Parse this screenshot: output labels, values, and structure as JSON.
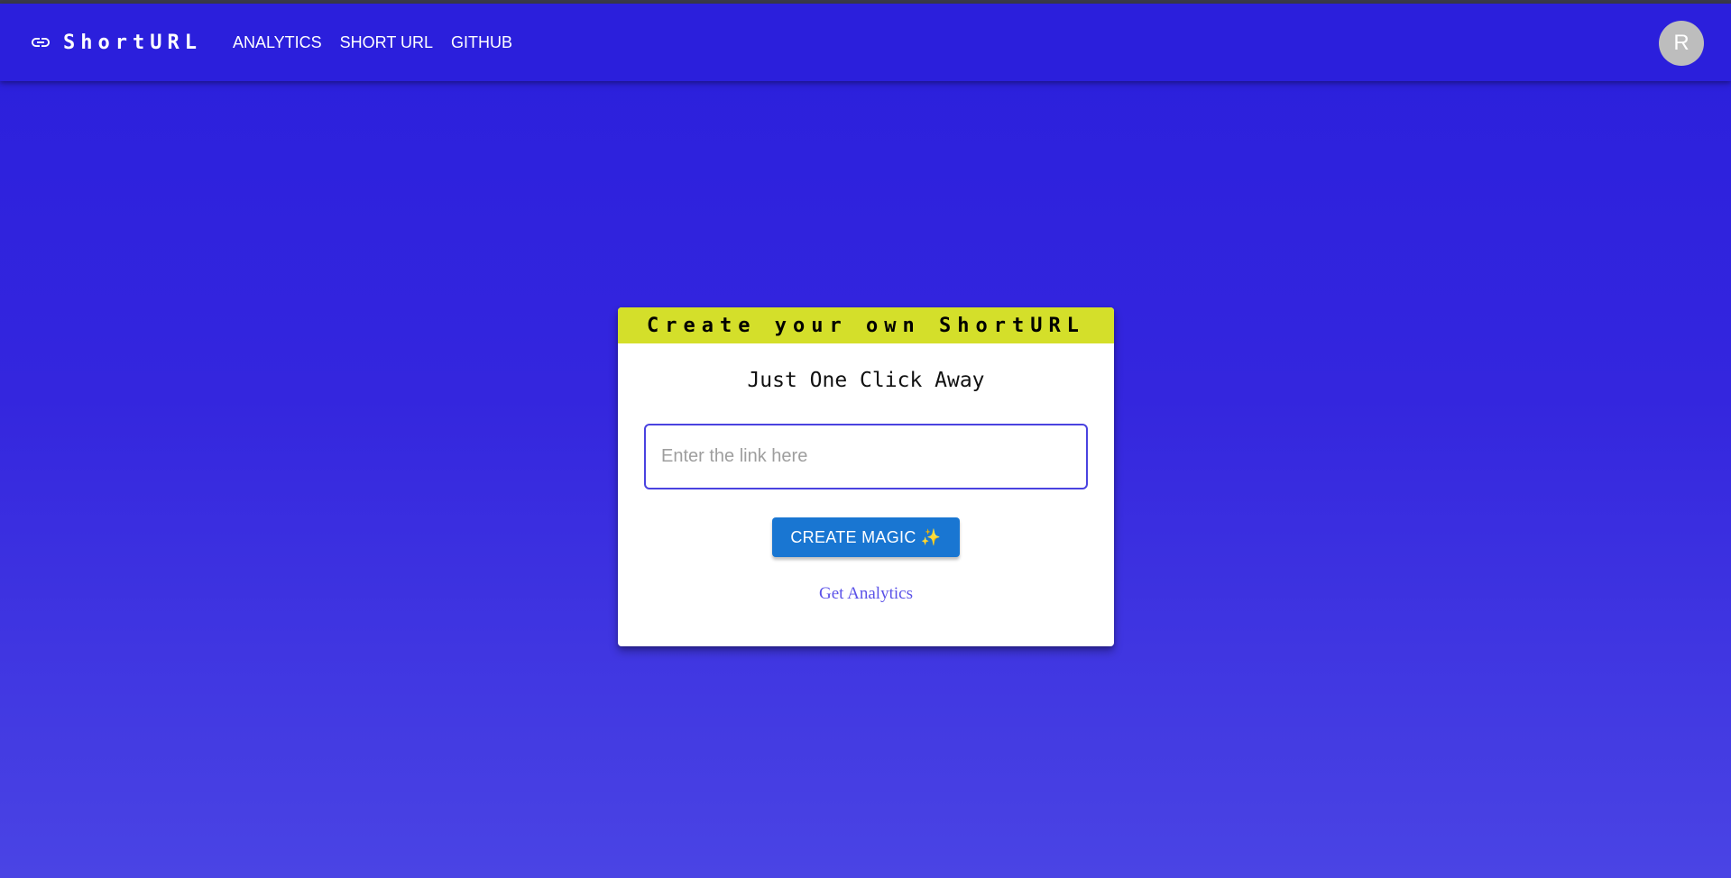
{
  "app": {
    "brand_name": "ShortURL",
    "brand_icon": "link-icon"
  },
  "nav": {
    "items": [
      {
        "label": "ANALYTICS"
      },
      {
        "label": "SHORT URL"
      },
      {
        "label": "GITHUB"
      }
    ]
  },
  "user": {
    "avatar_initial": "R"
  },
  "card": {
    "header": "Create your own ShortURL",
    "subtitle": "Just One Click Away",
    "input_placeholder": "Enter the link here",
    "input_value": "",
    "button_label": "CREATE MAGIC ✨",
    "analytics_link": "Get Analytics"
  },
  "colors": {
    "appbar": "#2b1fdc",
    "background_top": "#2a1fdc",
    "background_bottom": "#4a44e4",
    "card_header": "#d4df2a",
    "button": "#1976d2",
    "link": "#5b52e8"
  }
}
